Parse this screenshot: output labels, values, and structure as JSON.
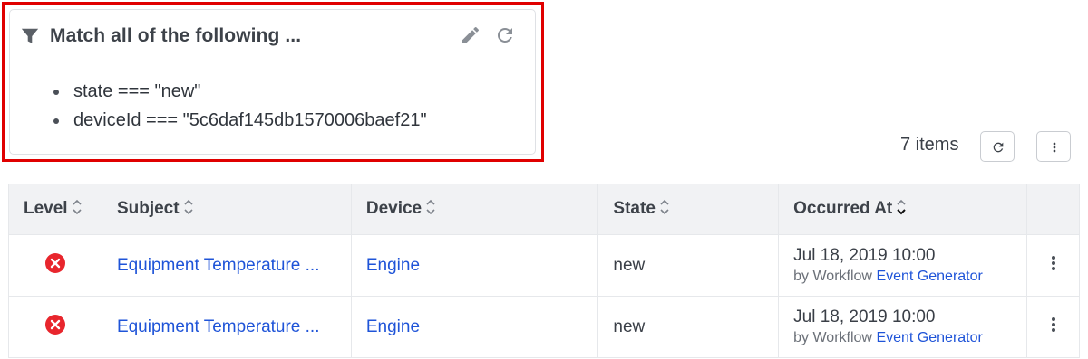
{
  "filter": {
    "title": "Match all of the following ...",
    "conditions": [
      "state === \"new\"",
      "deviceId === \"5c6daf145db1570006baef21\""
    ]
  },
  "toolbar": {
    "items_count": "7 items"
  },
  "table": {
    "headers": [
      "Level",
      "Subject",
      "Device",
      "State",
      "Occurred At"
    ],
    "rows": [
      {
        "level": "error",
        "subject": "Equipment Temperature ...",
        "device": "Engine",
        "state": "new",
        "occurred_at": "Jul 18, 2019 10:00",
        "by_prefix": "by Workflow",
        "by_link": "Event Generator"
      },
      {
        "level": "error",
        "subject": "Equipment Temperature ...",
        "device": "Engine",
        "state": "new",
        "occurred_at": "Jul 18, 2019 10:00",
        "by_prefix": "by Workflow",
        "by_link": "Event Generator"
      }
    ]
  },
  "colors": {
    "highlight": "#e00000",
    "link": "#1f54d8",
    "error": "#e8262d"
  }
}
